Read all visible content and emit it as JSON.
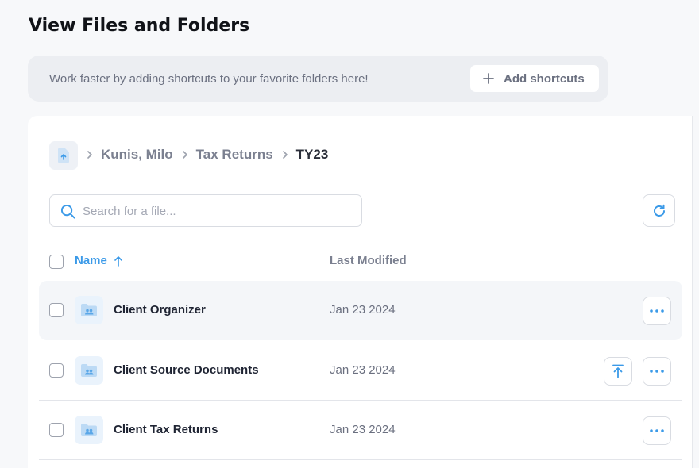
{
  "page": {
    "title": "View Files and Folders"
  },
  "shortcuts": {
    "message": "Work faster by adding shortcuts to your favorite folders here!",
    "add_label": "Add shortcuts"
  },
  "breadcrumb": {
    "items": [
      "Kunis, Milo",
      "Tax Returns",
      "TY23"
    ]
  },
  "search": {
    "placeholder": "Search for a file...",
    "value": ""
  },
  "table": {
    "columns": {
      "name": "Name",
      "last_modified": "Last Modified"
    },
    "sort": {
      "column": "name",
      "direction": "ascending"
    },
    "rows": [
      {
        "name": "Client Organizer",
        "modified": "Jan 23 2024",
        "has_upload": false
      },
      {
        "name": "Client Source Documents",
        "modified": "Jan 23 2024",
        "has_upload": true
      },
      {
        "name": "Client Tax Returns",
        "modified": "Jan 23 2024",
        "has_upload": false
      }
    ]
  },
  "icons": {
    "root": "folder-upload-icon",
    "folder": "shared-folder-icon",
    "search": "search-icon",
    "refresh": "refresh-icon",
    "more": "more-dots-icon",
    "upload": "upload-icon"
  },
  "colors": {
    "accent": "#3b9ae8",
    "folder_bg": "#eaf3fc",
    "banner_bg": "#eceef2"
  }
}
